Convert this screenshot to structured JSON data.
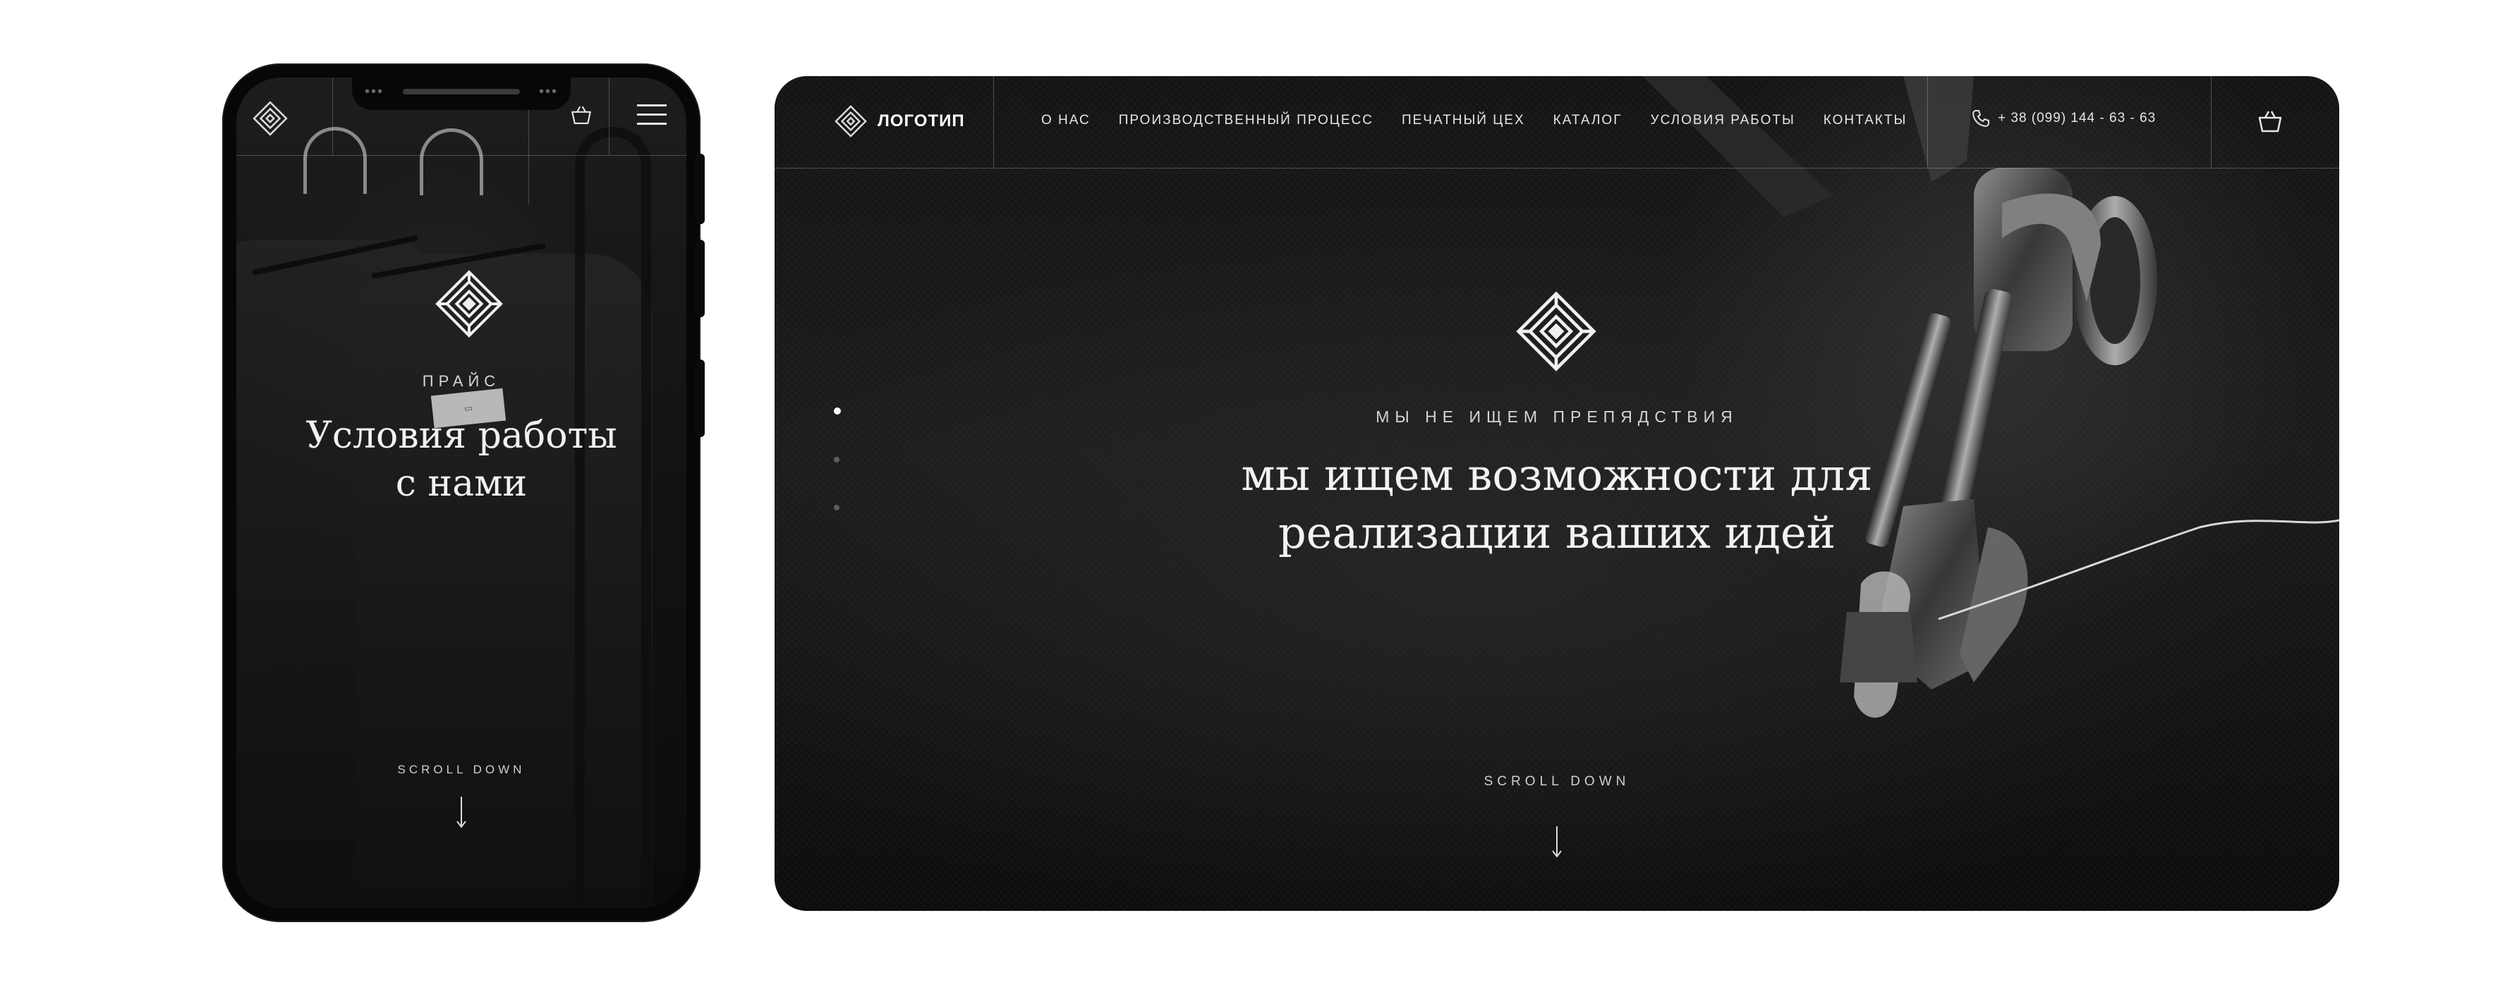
{
  "mobile": {
    "eyebrow": "ПРАЙС",
    "title_line1": "Условия работы",
    "title_line2": "с нами",
    "scroll_label": "SCROLL DOWN",
    "icons": [
      "ornament-logo-icon",
      "cart-icon",
      "burger-menu-icon",
      "arrow-down-icon"
    ]
  },
  "desktop": {
    "logo_text": "ЛОГОТИП",
    "nav": [
      {
        "label": "О НАС"
      },
      {
        "label": "ПРОИЗВОДСТВЕННЫЙ ПРОЦЕСС"
      },
      {
        "label": "ПЕЧАТНЫЙ ЦЕХ"
      },
      {
        "label": "КАТАЛОГ"
      },
      {
        "label": "УСЛОВИЯ РАБОТЫ"
      },
      {
        "label": "КОНТАКТЫ"
      }
    ],
    "phone": "+ 38 (099) 144 - 63 - 63",
    "eyebrow": "МЫ НЕ ИЩЕМ ПРЕПЯДСТВИЯ",
    "title_line1": "мы ищем возможности для",
    "title_line2": "реализации ваших идей",
    "scroll_label": "SCROLL DOWN",
    "slider_active_index": 0,
    "slider_count": 3
  },
  "colors": {
    "background": "#0e0e0e",
    "text": "#f2f2f2",
    "divider": "rgba(255,255,255,0.25)",
    "page": "#ffffff"
  }
}
